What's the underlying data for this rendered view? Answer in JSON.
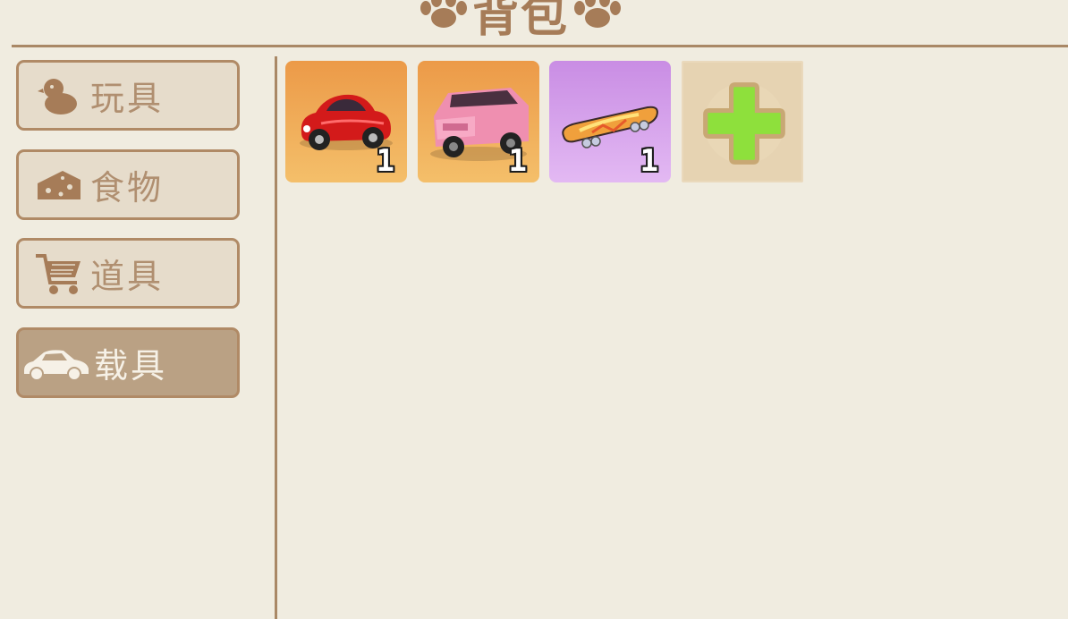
{
  "header": {
    "title": "背包",
    "title_color": "#a67c58"
  },
  "categories": [
    {
      "label": "玩具",
      "icon": "duck-icon",
      "active": false
    },
    {
      "label": "食物",
      "icon": "cheese-icon",
      "active": false
    },
    {
      "label": "道具",
      "icon": "shopping-cart-icon",
      "active": false
    },
    {
      "label": "载具",
      "icon": "car-icon",
      "active": true
    }
  ],
  "inventory": {
    "items": [
      {
        "name": "red-beetle-car",
        "icon": "red-car-icon",
        "count": "1",
        "rarity_color": "#ec9a48"
      },
      {
        "name": "pink-suv",
        "icon": "pink-suv-icon",
        "count": "1",
        "rarity_color": "#ec9a48"
      },
      {
        "name": "skateboard",
        "icon": "skateboard-icon",
        "count": "1",
        "rarity_color": "#c98de4"
      }
    ],
    "add_slot_icon": "plus-icon"
  },
  "colors": {
    "background": "#f0ece0",
    "border": "#a98866",
    "tab_bg": "#e6dccb",
    "tab_active_bg": "#baa184",
    "plus_green": "#8ee03c"
  }
}
